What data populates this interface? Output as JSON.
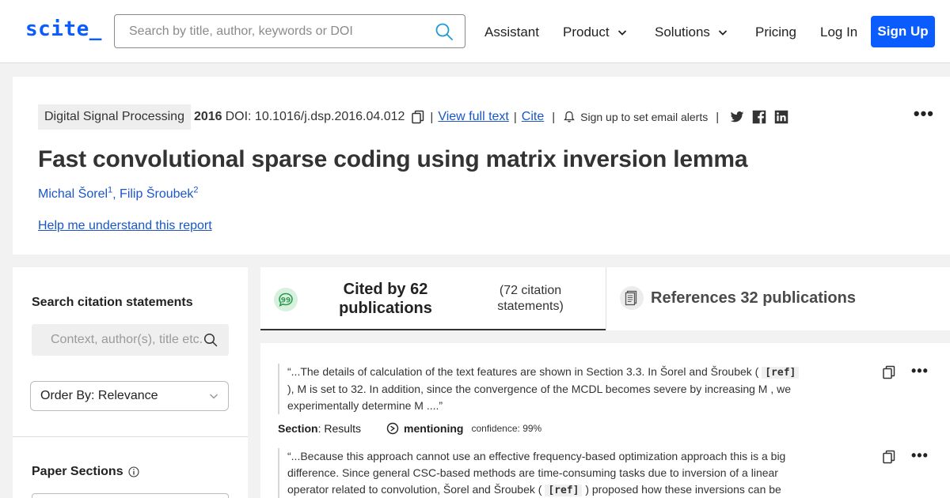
{
  "header": {
    "logo": "scite_",
    "search_placeholder": "Search by title, author, keywords or DOI",
    "nav": {
      "assistant": "Assistant",
      "product": "Product",
      "solutions": "Solutions",
      "pricing": "Pricing",
      "login": "Log In",
      "signup": "Sign Up"
    },
    "brand_color": "#0b5cff"
  },
  "paper": {
    "journal": "Digital Signal Processing",
    "year": "2016",
    "doi": "DOI: 10.1016/j.dsp.2016.04.012",
    "view_full_text": "View full text",
    "cite": "Cite",
    "email_alert": "Sign up to set email alerts",
    "title": "Fast convolutional sparse coding using matrix inversion lemma",
    "authors": [
      {
        "name": "Michal Šorel",
        "sup": "1"
      },
      {
        "name": "Filip Šroubek",
        "sup": "2"
      }
    ],
    "help_link": "Help me understand this report",
    "social_icons": [
      "twitter-icon",
      "facebook-icon",
      "linkedin-icon"
    ]
  },
  "sidebar": {
    "search_label": "Search citation statements",
    "search_placeholder": "Context, author(s), title etc.",
    "order_by": "Order By: Relevance",
    "sections_label": "Paper Sections"
  },
  "tabs": {
    "cited_by": "Cited by 62 publications",
    "citation_statements": "(72 citation statements)",
    "references": "References 32 publications"
  },
  "citations": [
    {
      "before": "“...The details of calculation of the text features are shown in Section 3.3. In Šorel and Šroubek (",
      "ref": "[ref]",
      "after": "), M is set to 32. In addition, since the convergence of the MCDL becomes severe by increasing M , we experimentally determine M ....”",
      "section_key": "Section",
      "section_value": ": Results",
      "type": "mentioning",
      "confidence": "confidence: 99%"
    },
    {
      "before": "“...Because this approach cannot use an effective frequency-based optimization approach this is a big difference. Since general CSC-based methods are time-consuming tasks due to inversion of a linear operator related to convolution, Šorel and Šroubek (",
      "ref": "[ref]",
      "after": ") proposed how these inversions can be"
    }
  ]
}
